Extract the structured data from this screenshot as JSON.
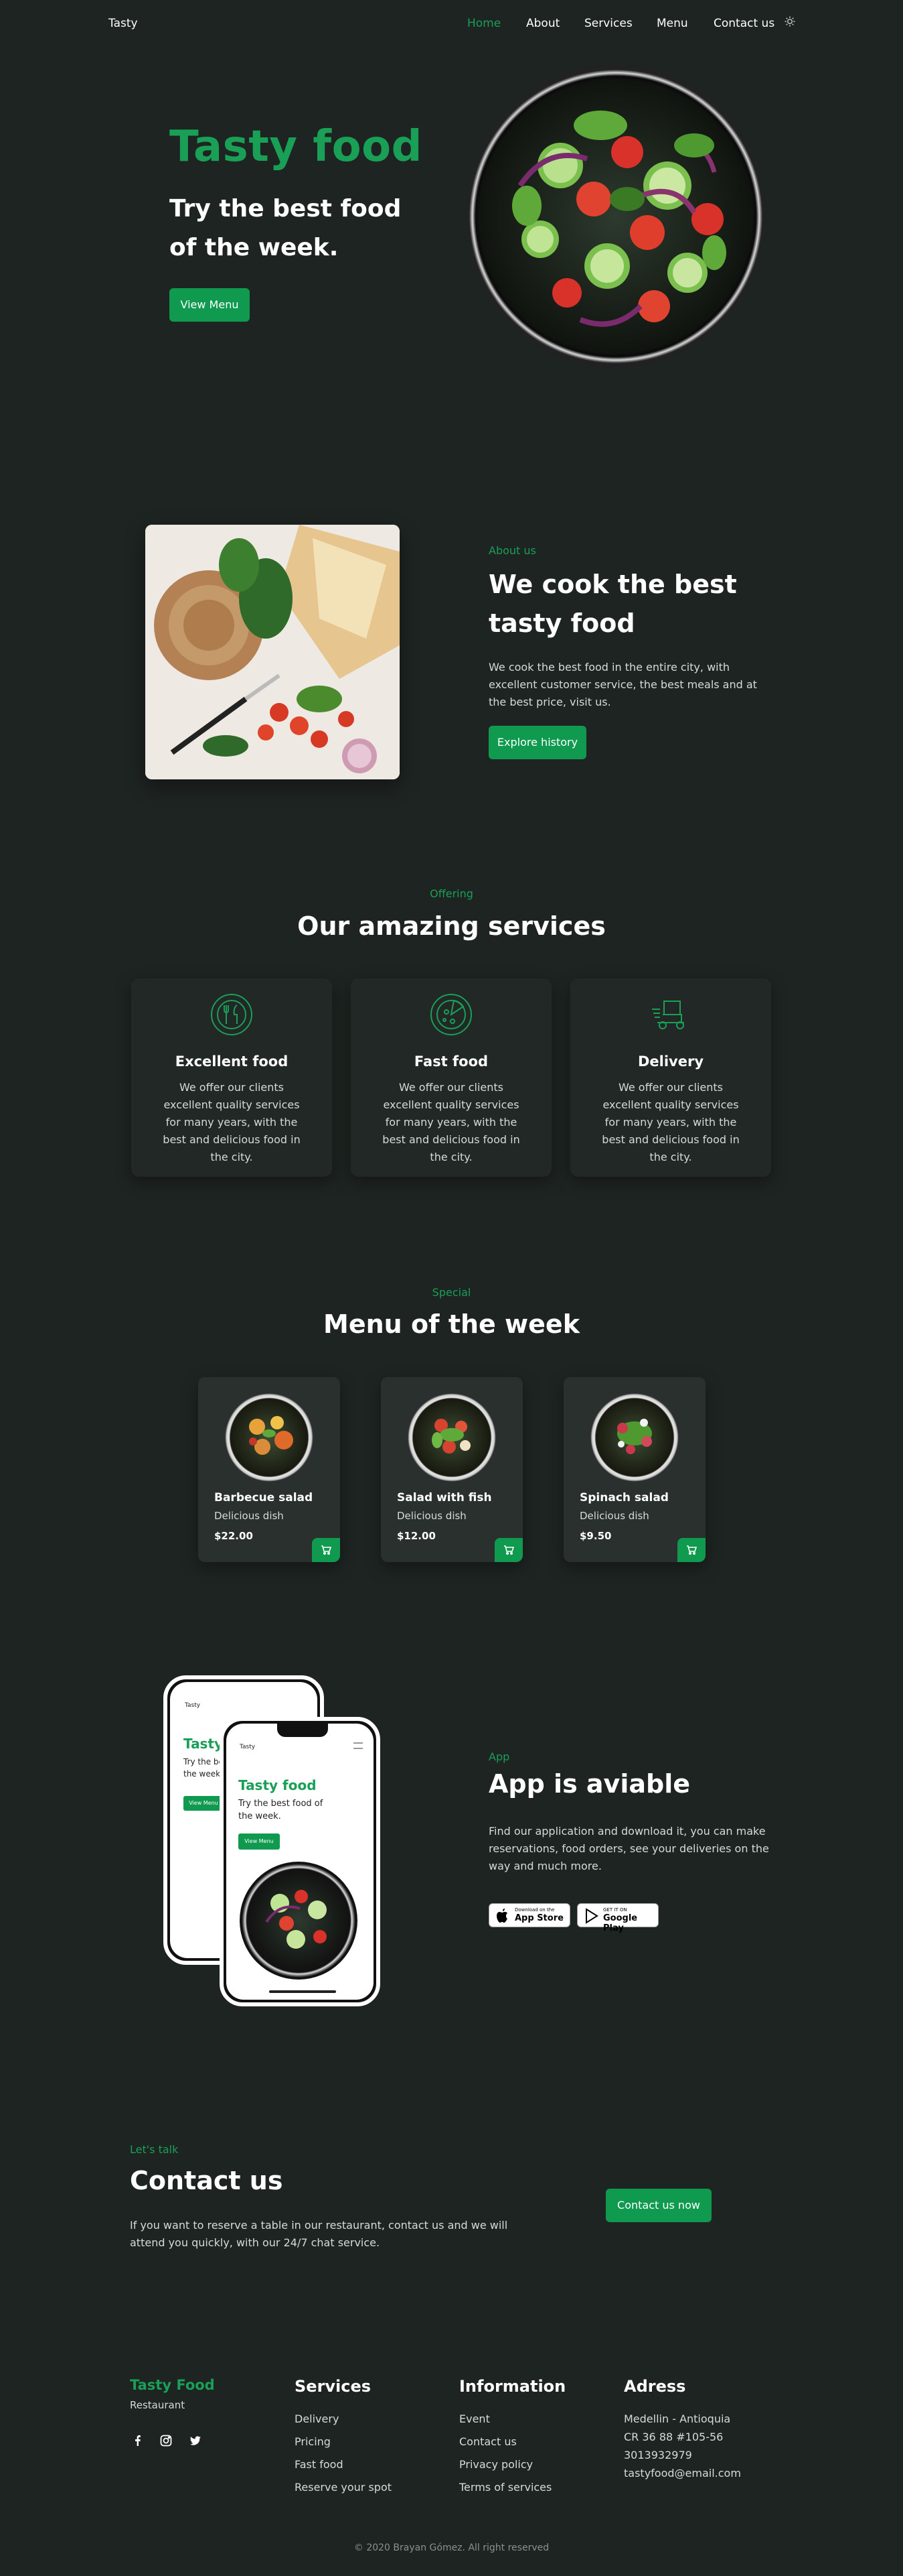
{
  "header": {
    "logo": "Tasty",
    "nav": [
      {
        "label": "Home",
        "active": true
      },
      {
        "label": "About",
        "active": false
      },
      {
        "label": "Services",
        "active": false
      },
      {
        "label": "Menu",
        "active": false
      },
      {
        "label": "Contact us",
        "active": false
      }
    ],
    "theme_icon": "moon-icon"
  },
  "hero": {
    "title": "Tasty food",
    "subtitle": "Try the best food of the week.",
    "button": "View Menu"
  },
  "about": {
    "tag": "About us",
    "title": "We cook the best tasty food",
    "description": "We cook the best food in the entire city, with excellent customer service, the best meals and at the best price, visit us.",
    "button": "Explore history"
  },
  "services": {
    "tag": "Offering",
    "title": "Our amazing services",
    "items": [
      {
        "title": "Excellent food",
        "description": "We offer our clients excellent quality services for many years, with the best and delicious food in the city.",
        "icon": "plate-cutlery-icon"
      },
      {
        "title": "Fast food",
        "description": "We offer our clients excellent quality services for many years, with the best and delicious food in the city.",
        "icon": "pizza-icon"
      },
      {
        "title": "Delivery",
        "description": "We offer our clients excellent quality services for many years, with the best and delicious food in the city.",
        "icon": "delivery-scooter-icon"
      }
    ]
  },
  "menu": {
    "tag": "Special",
    "title": "Menu of the week",
    "items": [
      {
        "name": "Barbecue salad",
        "subtitle": "Delicious dish",
        "price": "$22.00"
      },
      {
        "name": "Salad with fish",
        "subtitle": "Delicious dish",
        "price": "$12.00"
      },
      {
        "name": "Spinach salad",
        "subtitle": "Delicious dish",
        "price": "$9.50"
      }
    ]
  },
  "app": {
    "tag": "App",
    "title": "App is aviable",
    "description": "Find our application and download it, you can make reservations, food orders, see your deliveries on the way and much more.",
    "phone": {
      "logo": "Tasty",
      "title": "Tasty food",
      "subtitle": "Try the best food of the week.",
      "button": "View Menu"
    },
    "app_store": {
      "small": "Download on the",
      "big": "App Store"
    },
    "google_play": {
      "small": "GET IT ON",
      "big": "Google Play"
    }
  },
  "contact": {
    "tag": "Let's talk",
    "title": "Contact us",
    "description": "If you want to reserve a table in our restaurant, contact us and we will attend you quickly, with our 24/7 chat service.",
    "button": "Contact us now"
  },
  "footer": {
    "brand": "Tasty Food",
    "brand_sub": "Restaurant",
    "social": [
      "facebook-icon",
      "instagram-icon",
      "twitter-icon"
    ],
    "columns": [
      {
        "title": "Services",
        "links": [
          "Delivery",
          "Pricing",
          "Fast food",
          "Reserve your spot"
        ]
      },
      {
        "title": "Information",
        "links": [
          "Event",
          "Contact us",
          "Privacy policy",
          "Terms of services"
        ]
      },
      {
        "title": "Adress",
        "links": [
          "Medellin - Antioquia",
          "CR 36 88 #105-56",
          "3013932979",
          "tastyfood@email.com"
        ]
      }
    ],
    "copyright": "© 2020 Brayan Gómez. All right reserved"
  },
  "colors": {
    "background": "#1e2421",
    "accent": "#1a9f57",
    "button": "#0f9a4f",
    "card": "#222826"
  }
}
